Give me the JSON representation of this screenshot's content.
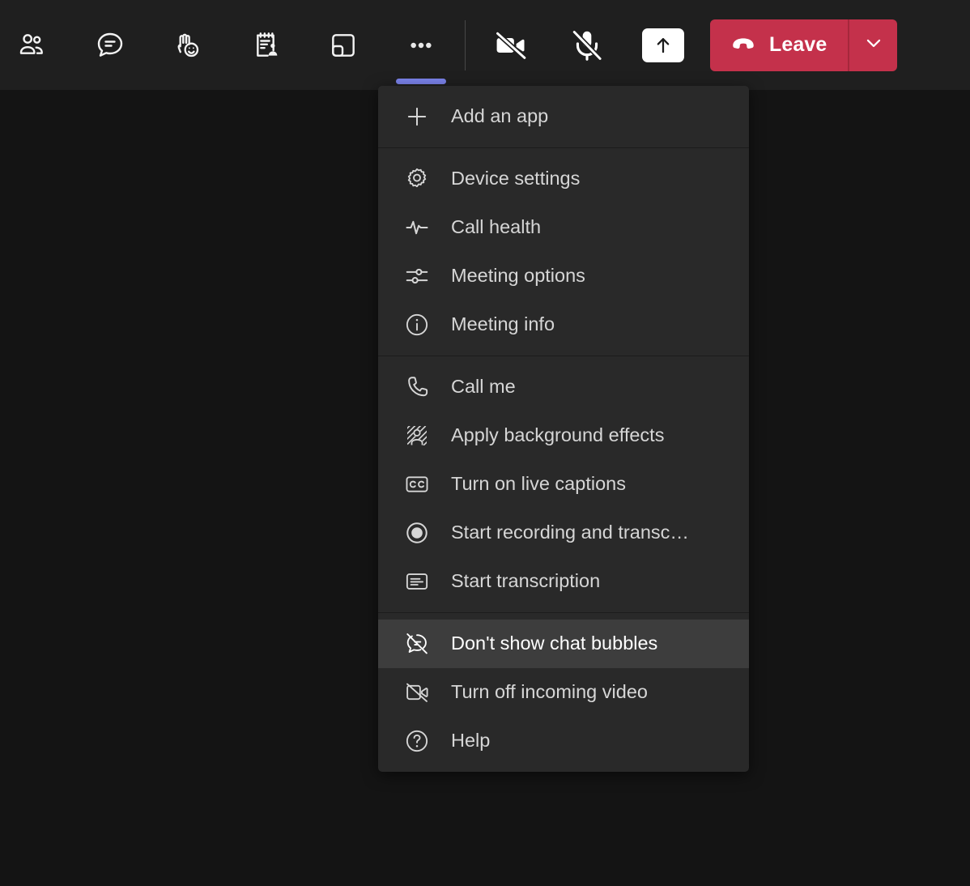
{
  "toolbar": {
    "buttons": [
      {
        "name": "people-icon",
        "tooltip": "People"
      },
      {
        "name": "chat-icon",
        "tooltip": "Chat"
      },
      {
        "name": "reactions-icon",
        "tooltip": "Reactions"
      },
      {
        "name": "notes-icon",
        "tooltip": "Notes"
      },
      {
        "name": "rooms-icon",
        "tooltip": "Breakout rooms"
      },
      {
        "name": "more-icon",
        "tooltip": "More actions",
        "active": true
      }
    ],
    "camera": {
      "name": "camera-off-icon",
      "tooltip": "Turn camera on",
      "state": "off"
    },
    "mic": {
      "name": "mic-off-icon",
      "tooltip": "Unmute",
      "state": "off"
    },
    "share": {
      "name": "share-screen-icon",
      "tooltip": "Share content",
      "state": "active"
    },
    "leave": {
      "label": "Leave",
      "icon": "hangup-icon",
      "caret_icon": "chevron-down-icon",
      "color": "#c4314b"
    },
    "active_indicator_color": "#7b83eb"
  },
  "menu": {
    "name": "more-actions-menu",
    "background": "#292929",
    "hover_background": "#3d3d3d",
    "groups": [
      {
        "items": [
          {
            "icon": "plus-icon",
            "label": "Add an app"
          }
        ]
      },
      {
        "items": [
          {
            "icon": "gear-icon",
            "label": "Device settings"
          },
          {
            "icon": "pulse-icon",
            "label": "Call health"
          },
          {
            "icon": "sliders-icon",
            "label": "Meeting options"
          },
          {
            "icon": "info-circle-icon",
            "label": "Meeting info"
          }
        ]
      },
      {
        "items": [
          {
            "icon": "phone-icon",
            "label": "Call me"
          },
          {
            "icon": "background-effects-icon",
            "label": "Apply background effects"
          },
          {
            "icon": "closed-captions-icon",
            "label": "Turn on live captions"
          },
          {
            "icon": "record-icon",
            "label": "Start recording and transc…"
          },
          {
            "icon": "transcription-icon",
            "label": "Start transcription"
          }
        ]
      },
      {
        "items": [
          {
            "icon": "chat-bubble-off-icon",
            "label": "Don't show chat bubbles",
            "hovered": true
          },
          {
            "icon": "video-off-icon",
            "label": "Turn off incoming video"
          },
          {
            "icon": "help-circle-icon",
            "label": "Help"
          }
        ]
      }
    ]
  }
}
